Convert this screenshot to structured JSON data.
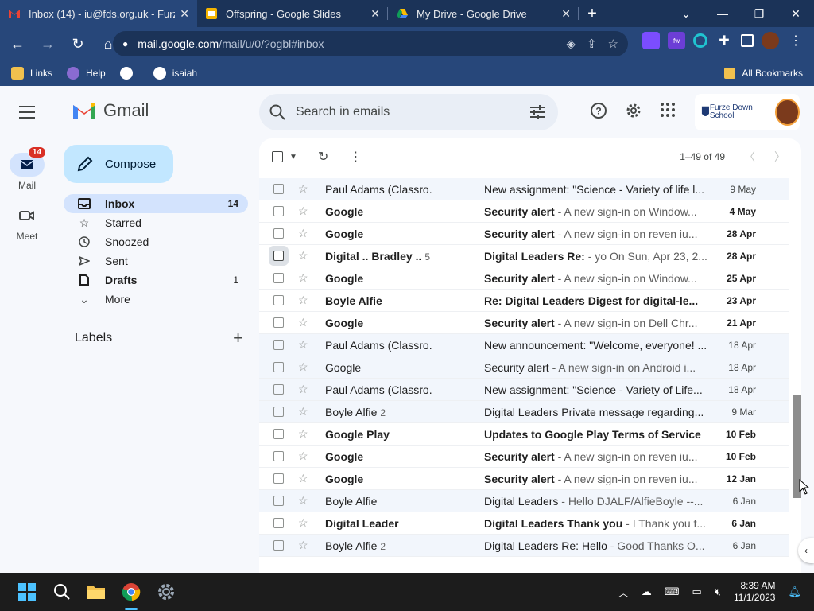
{
  "browser": {
    "tabs": [
      {
        "title": "Inbox (14) - iu@fds.org.uk - Furz",
        "favicon": "gmail-icon"
      },
      {
        "title": "Offspring - Google Slides",
        "favicon": "slides-icon"
      },
      {
        "title": "My Drive - Google Drive",
        "favicon": "drive-icon"
      }
    ],
    "url_host": "mail.google.com",
    "url_path": "/mail/u/0/?ogbl#inbox",
    "bookmarks": [
      "Links",
      "Help",
      "",
      "isaiah"
    ],
    "all_bookmarks": "All Bookmarks"
  },
  "gmail": {
    "product": "Gmail",
    "search_placeholder": "Search in emails",
    "school_name": "Furze Down School",
    "rail": [
      {
        "label": "Mail",
        "badge": "14"
      },
      {
        "label": "Meet"
      }
    ],
    "compose": "Compose",
    "nav": [
      {
        "label": "Inbox",
        "count": "14",
        "icon": "inbox-icon",
        "active": true
      },
      {
        "label": "Starred",
        "count": "",
        "icon": "star-icon"
      },
      {
        "label": "Snoozed",
        "count": "",
        "icon": "clock-icon"
      },
      {
        "label": "Sent",
        "count": "",
        "icon": "send-icon"
      },
      {
        "label": "Drafts",
        "count": "1",
        "icon": "draft-icon",
        "bold": true
      },
      {
        "label": "More",
        "count": "",
        "icon": "chevron-down-icon"
      }
    ],
    "labels_heading": "Labels",
    "pager": "1–49 of 49",
    "emails": [
      {
        "sender": "Paul Adams (Classro.",
        "count": "",
        "subject": "New assignment: \"Science - Variety of life l...",
        "snippet": "",
        "date": "9 May",
        "unread": false
      },
      {
        "sender": "Google",
        "count": "",
        "subject": "Security alert",
        "snippet": " - A new sign-in on Window...",
        "date": "4 May",
        "unread": true
      },
      {
        "sender": "Google",
        "count": "",
        "subject": "Security alert",
        "snippet": " - A new sign-in on reven iu...",
        "date": "28 Apr",
        "unread": true
      },
      {
        "sender": "Digital .. Bradley ..",
        "count": "5",
        "subject": "Digital Leaders Re:",
        "snippet": " - yo On Sun, Apr 23, 2...",
        "date": "28 Apr",
        "unread": true,
        "partial": true
      },
      {
        "sender": "Google",
        "count": "",
        "subject": "Security alert",
        "snippet": " - A new sign-in on Window...",
        "date": "25 Apr",
        "unread": true
      },
      {
        "sender": "Boyle Alfie",
        "count": "",
        "subject": "Re: Digital Leaders Digest for digital-le...",
        "snippet": "",
        "date": "23 Apr",
        "unread": true
      },
      {
        "sender": "Google",
        "count": "",
        "subject": "Security alert",
        "snippet": " - A new sign-in on Dell Chr...",
        "date": "21 Apr",
        "unread": true
      },
      {
        "sender": "Paul Adams (Classro.",
        "count": "",
        "subject": "New announcement: \"Welcome, everyone! ...",
        "snippet": "",
        "date": "18 Apr",
        "unread": false
      },
      {
        "sender": "Google",
        "count": "",
        "subject": "Security alert",
        "snippet": " - A new sign-in on Android i...",
        "date": "18 Apr",
        "unread": false
      },
      {
        "sender": "Paul Adams (Classro.",
        "count": "",
        "subject": "New assignment: \"Science - Variety of Life...",
        "snippet": "",
        "date": "18 Apr",
        "unread": false
      },
      {
        "sender": "Boyle Alfie",
        "count": "2",
        "subject": "Digital Leaders Private message regarding...",
        "snippet": "",
        "date": "9 Mar",
        "unread": false
      },
      {
        "sender": "Google Play",
        "count": "",
        "subject": "Updates to Google Play Terms of Service",
        "snippet": "",
        "date": "10 Feb",
        "unread": true
      },
      {
        "sender": "Google",
        "count": "",
        "subject": "Security alert",
        "snippet": " - A new sign-in on reven iu...",
        "date": "10 Feb",
        "unread": true
      },
      {
        "sender": "Google",
        "count": "",
        "subject": "Security alert",
        "snippet": " - A new sign-in on reven iu...",
        "date": "12 Jan",
        "unread": true
      },
      {
        "sender": "Boyle Alfie",
        "count": "",
        "subject": "Digital Leaders",
        "snippet": " - Hello DJALF/AlfieBoyle --...",
        "date": "6 Jan",
        "unread": false
      },
      {
        "sender": "Digital Leader",
        "count": "",
        "subject": "Digital Leaders Thank you",
        "snippet": " - I Thank you f...",
        "date": "6 Jan",
        "unread": true
      },
      {
        "sender": "Boyle Alfie",
        "count": "2",
        "subject": "Digital Leaders Re: Hello",
        "snippet": " - Good Thanks O...",
        "date": "6 Jan",
        "unread": false
      }
    ]
  },
  "taskbar": {
    "time": "8:39 AM",
    "date": "11/1/2023"
  }
}
